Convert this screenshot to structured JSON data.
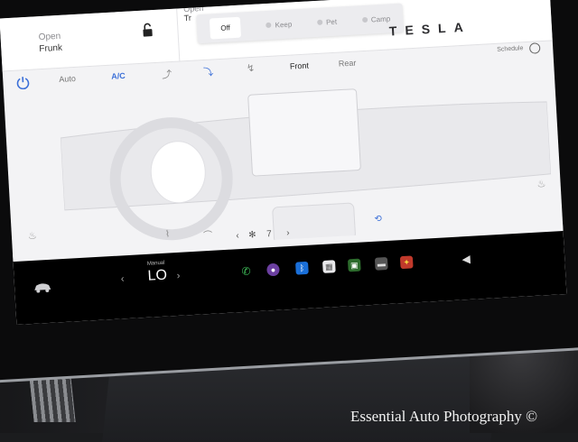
{
  "top": {
    "frunk_status": "Open",
    "frunk_label": "Frunk",
    "trunk_status": "Open",
    "trunk_label": "Tr",
    "brand": "TESLA"
  },
  "climate_modes": {
    "off": "Off",
    "keep": "Keep",
    "pet": "Pet",
    "camp": "Camp"
  },
  "climate": {
    "auto_label": "Auto",
    "ac_label": "A/C",
    "front_label": "Front",
    "rear_label": "Rear",
    "schedule_label": "Schedule",
    "fan_speed": "7"
  },
  "taskbar": {
    "temp_mode": "Manual",
    "temp_value": "LO"
  },
  "watermark": "Essential Auto Photography ©",
  "colors": {
    "accent": "#3b6fd8",
    "screen_bg": "#f3f3f5",
    "taskbar_bg": "#000000"
  }
}
